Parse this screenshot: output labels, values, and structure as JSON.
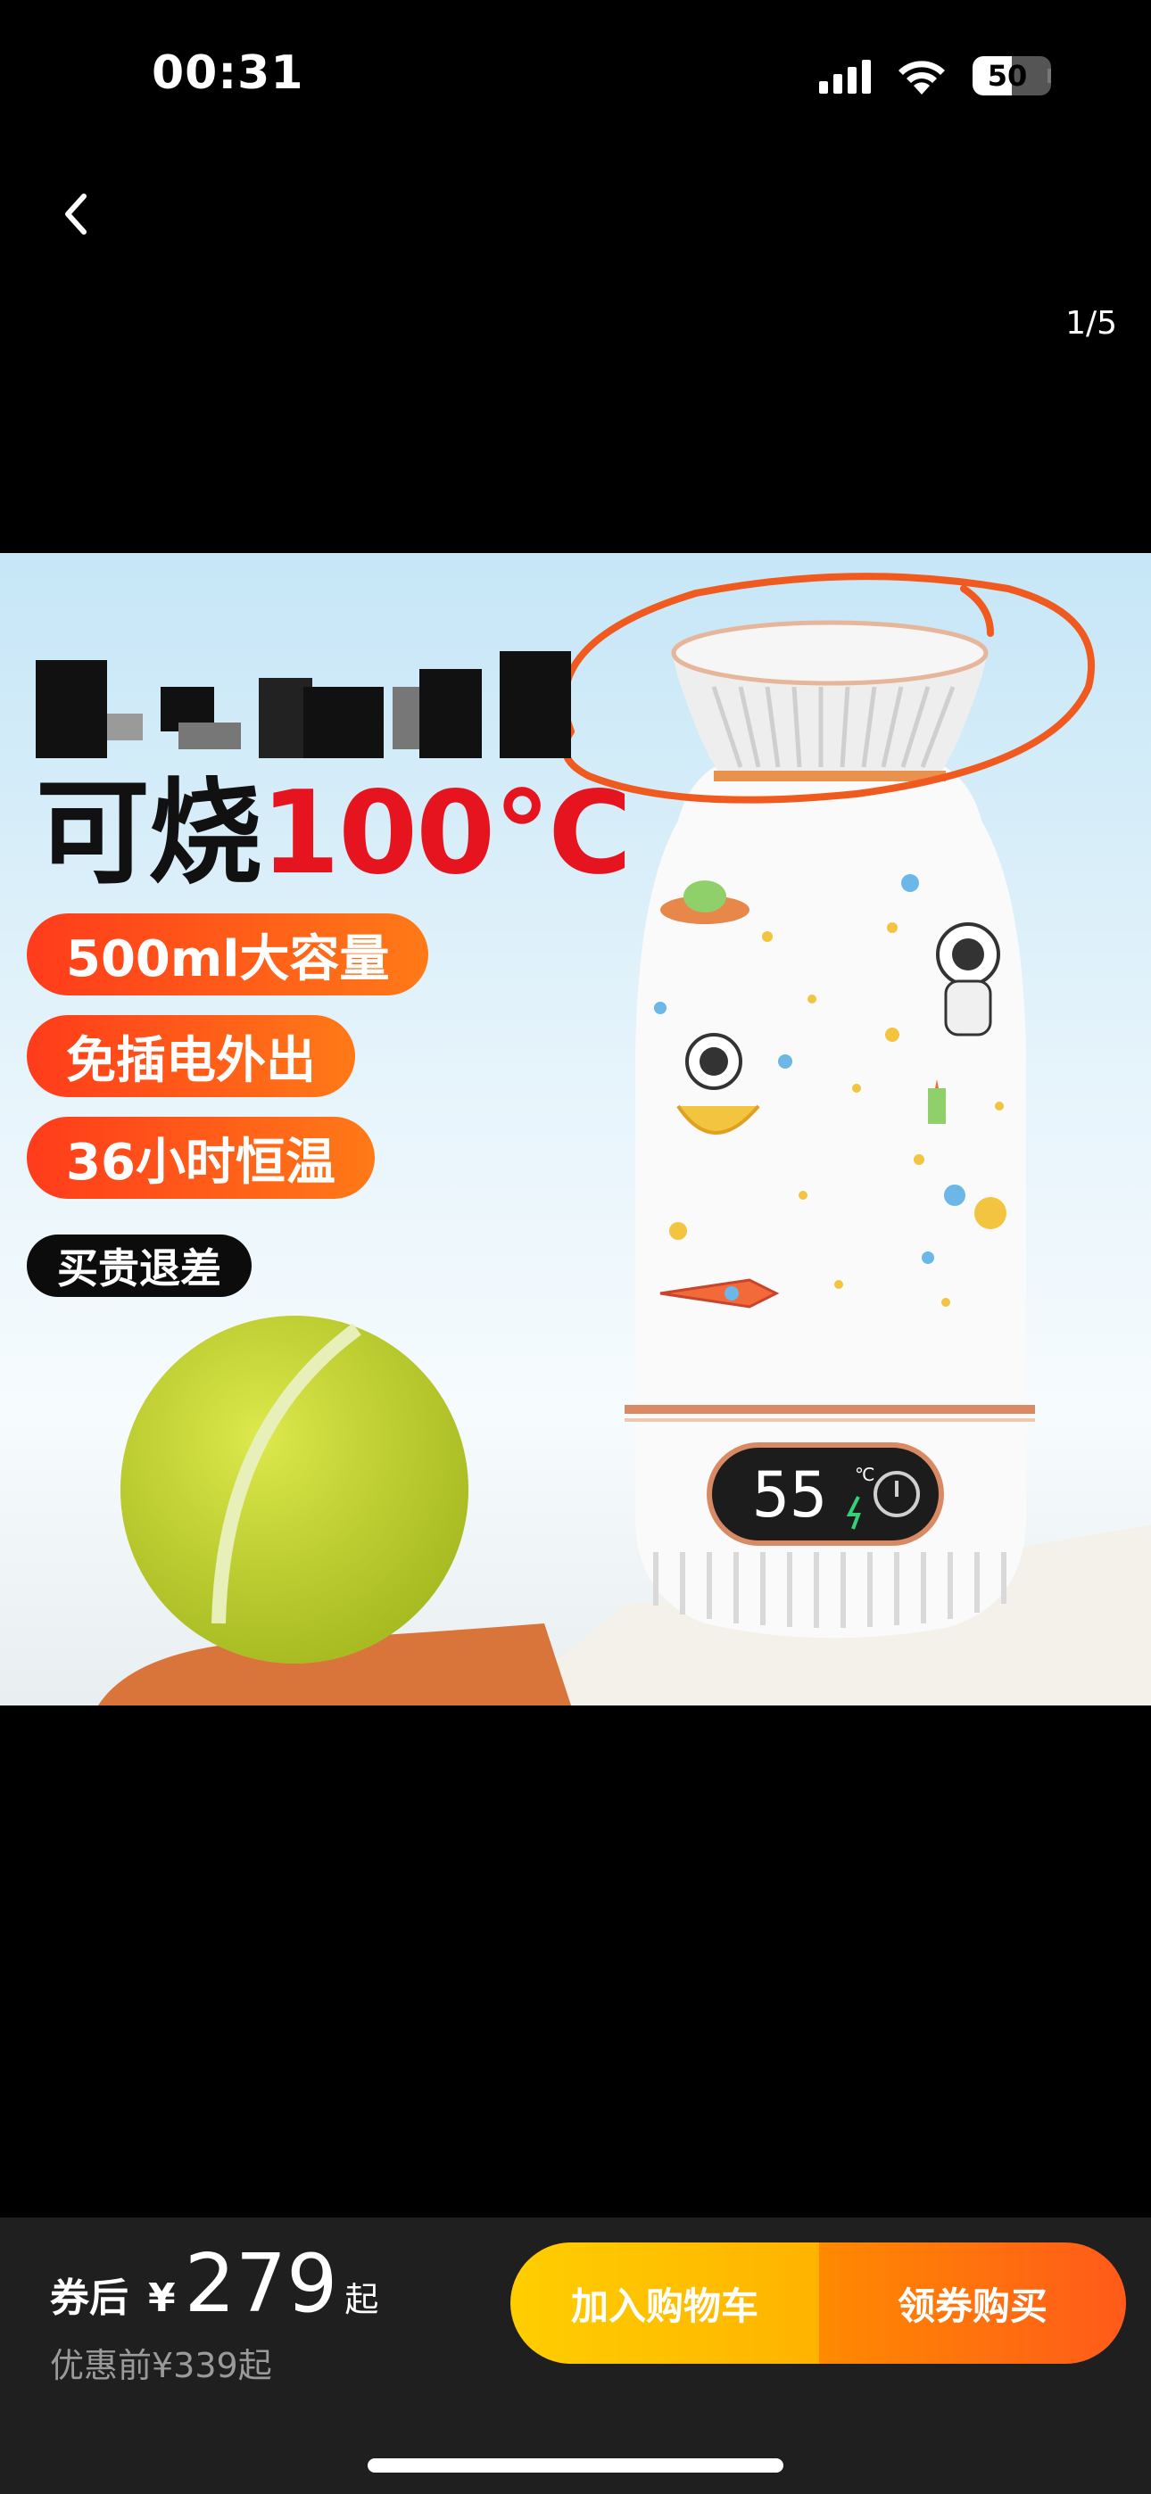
{
  "status_bar": {
    "time": "00:31",
    "battery": "50",
    "battery_level": 0.5
  },
  "nav": {
    "page_indicator": "1/5"
  },
  "product_image": {
    "headline_black": "可烧",
    "headline_red": "100℃",
    "tags": [
      "500ml大容量",
      "免插电外出",
      "36小时恒温"
    ],
    "black_tag": "买贵退差",
    "display_temp": "55",
    "display_unit": "℃"
  },
  "purchase": {
    "price_label": "券后",
    "currency": "¥",
    "price": "279",
    "price_suffix": "起",
    "original_price": "优惠前¥339起",
    "add_to_cart": "加入购物车",
    "buy_now": "领券购买"
  },
  "colors": {
    "cart_button": "#ffc200",
    "buy_button": "#ff6a10",
    "accent_red": "#e5141e",
    "annotation": "#f05a1e"
  }
}
